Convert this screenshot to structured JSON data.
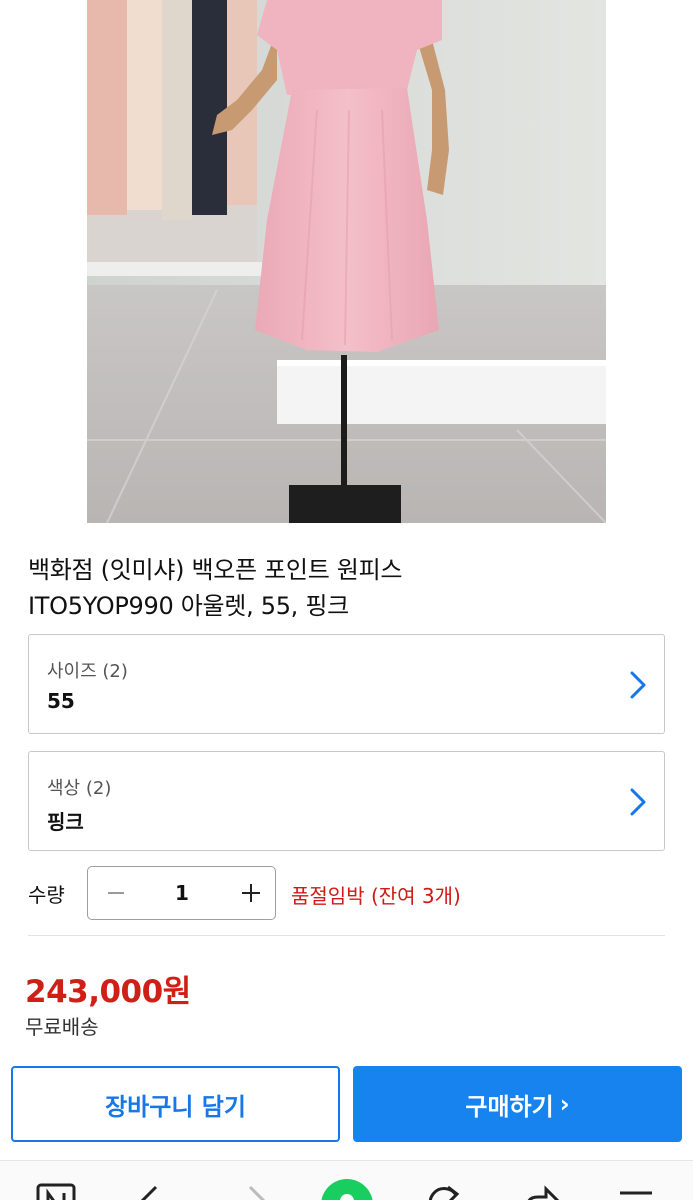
{
  "product": {
    "title_line1": "백화점 (잇미샤) 백오픈 포인트 원피스",
    "title_line2": "ITO5YOP990 아울렛, 55, 핑크"
  },
  "options": {
    "size": {
      "label": "사이즈 (2)",
      "value": "55"
    },
    "color": {
      "label": "색상 (2)",
      "value": "핑크"
    }
  },
  "quantity": {
    "label": "수량",
    "value": "1",
    "stock_notice": "품절임박 (잔여 3개)"
  },
  "price": {
    "amount": "243,000원",
    "shipping": "무료배송"
  },
  "actions": {
    "add_to_cart": "장바구니 담기",
    "buy_now": "구매하기",
    "buy_arrow": "›"
  },
  "colors": {
    "accent_blue": "#1683ee",
    "price_red": "#cf1f16",
    "dress_pink": "#f2b7c2"
  },
  "bottom_toolbar": {
    "icons": [
      "naver-n-icon",
      "back-arrow-icon",
      "forward-arrow-icon",
      "green-home-icon",
      "refresh-icon",
      "share-icon",
      "menu-icon"
    ]
  }
}
